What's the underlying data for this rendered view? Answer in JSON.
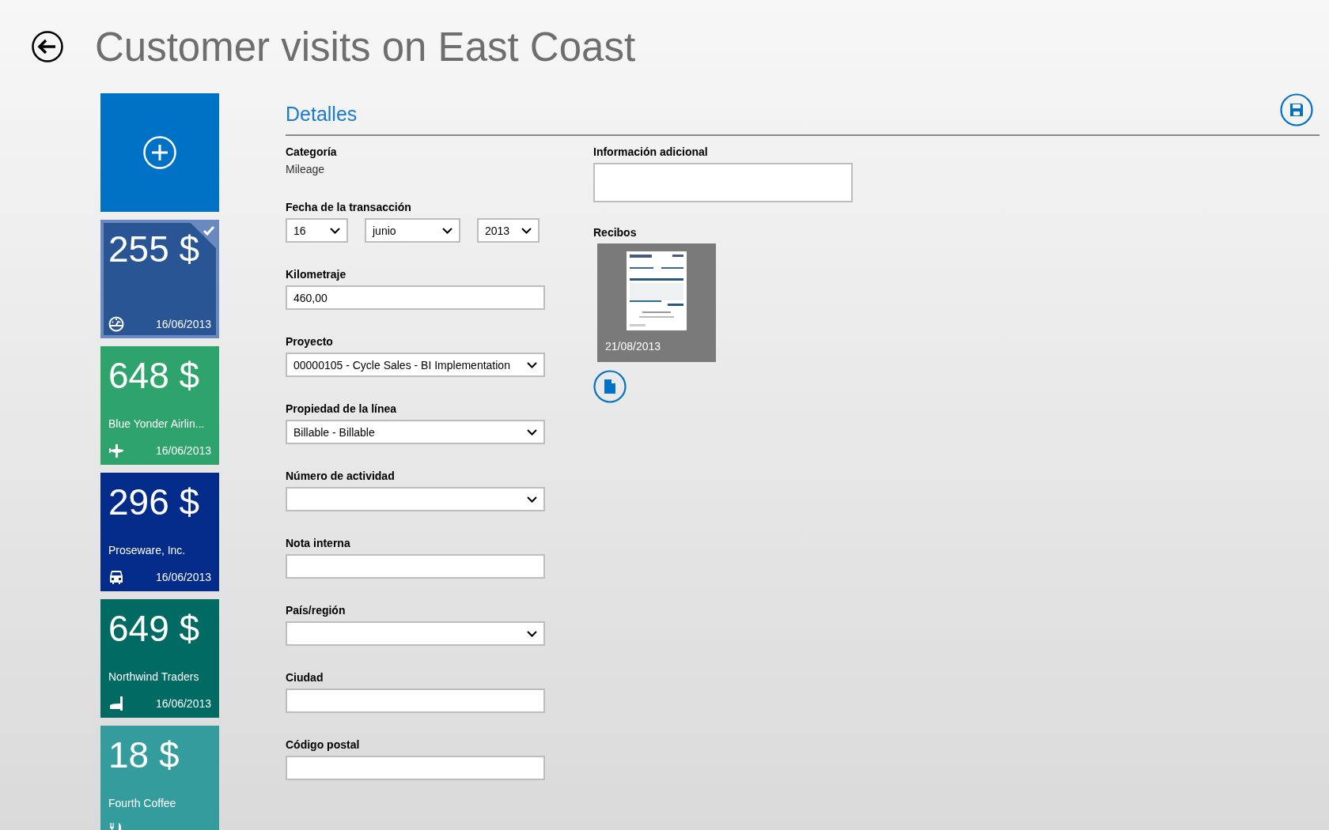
{
  "title": "Customer visits on East Coast",
  "tiles": [
    {
      "amount": "255 $",
      "date": "16/06/2013",
      "kind": "mileage",
      "color": "#2a5595",
      "selected": true
    },
    {
      "amount": "648 $",
      "name": "Blue Yonder Airlin...",
      "date": "16/06/2013",
      "kind": "flight",
      "color": "#2ea46c",
      "selected": false
    },
    {
      "amount": "296 $",
      "name": "Proseware, Inc.",
      "date": "16/06/2013",
      "kind": "car",
      "color": "#032b8a",
      "selected": false
    },
    {
      "amount": "649 $",
      "name": "Northwind Traders",
      "date": "16/06/2013",
      "kind": "hotel",
      "color": "#006a63",
      "selected": false
    },
    {
      "amount": "18 $",
      "name": "Fourth Coffee",
      "kind": "food",
      "color": "#349c9c",
      "selected": false
    }
  ],
  "section_title": "Detalles",
  "fields": [
    {
      "kind": "text",
      "label": "Categoría",
      "value": "Mileage"
    },
    {
      "kind": "date",
      "label": "Fecha de la transacción",
      "parts": [
        "16",
        "junio",
        "2013"
      ]
    },
    {
      "kind": "input",
      "label": "Kilometraje",
      "value": "460,00"
    },
    {
      "kind": "select",
      "label": "Proyecto",
      "value": "00000105 - Cycle Sales - BI Implementation"
    },
    {
      "kind": "select",
      "label": "Propiedad de la línea",
      "value": "Billable - Billable"
    },
    {
      "kind": "select",
      "label": "Número de actividad"
    },
    {
      "kind": "input",
      "label": "Nota interna"
    },
    {
      "kind": "select",
      "label": "País/región"
    },
    {
      "kind": "input",
      "label": "Ciudad"
    },
    {
      "kind": "input",
      "label": "Código postal"
    }
  ],
  "additional_info": {
    "label": "Información adicional"
  },
  "receipts": {
    "label": "Recibos",
    "items": [
      {
        "date": "21/08/2013"
      }
    ]
  }
}
